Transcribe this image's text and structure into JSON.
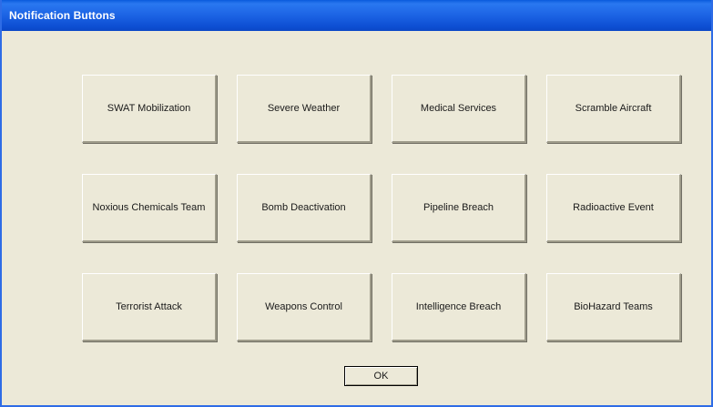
{
  "window": {
    "title": "Notification Buttons"
  },
  "buttons": [
    {
      "label": "SWAT Mobilization"
    },
    {
      "label": "Severe Weather"
    },
    {
      "label": "Medical Services"
    },
    {
      "label": "Scramble Aircraft"
    },
    {
      "label": "Noxious Chemicals Team"
    },
    {
      "label": "Bomb Deactivation"
    },
    {
      "label": "Pipeline Breach"
    },
    {
      "label": "Radioactive Event"
    },
    {
      "label": "Terrorist Attack"
    },
    {
      "label": "Weapons Control"
    },
    {
      "label": "Intelligence Breach"
    },
    {
      "label": "BioHazard Teams"
    }
  ],
  "ok_label": "OK",
  "colors": {
    "titlebar": "#1c63e4",
    "background": "#ece9d8",
    "title_text": "#ffffff"
  }
}
